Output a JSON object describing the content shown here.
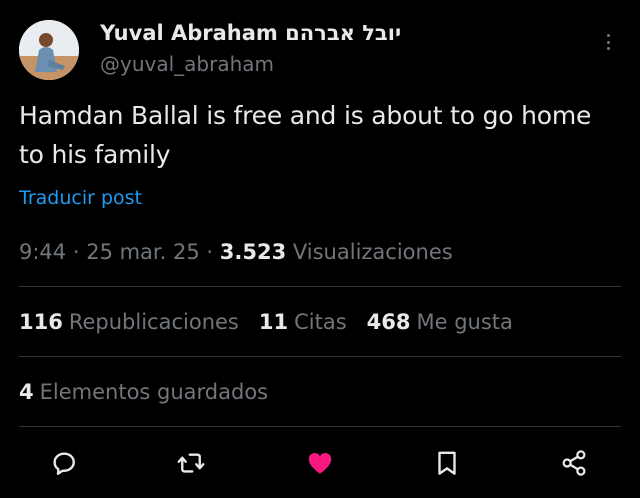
{
  "author": {
    "display_name": "Yuval Abraham יובל אברהם",
    "handle": "@yuval_abraham"
  },
  "post": {
    "text": "Hamdan Ballal is free and is about to go home to his family",
    "translate_label": "Traducir post"
  },
  "meta": {
    "time": "9:44",
    "date": "25 mar. 25",
    "views_count": "3.523",
    "views_label": "Visualizaciones"
  },
  "stats": {
    "reposts_count": "116",
    "reposts_label": "Republicaciones",
    "quotes_count": "11",
    "quotes_label": "Citas",
    "likes_count": "468",
    "likes_label": "Me gusta"
  },
  "saved": {
    "count": "4",
    "label": "Elementos guardados"
  },
  "colors": {
    "background": "#000000",
    "text_primary": "#e7e9ea",
    "text_secondary": "#71767b",
    "link": "#1d9bf0",
    "like_active": "#f91880",
    "divider": "#2f3336"
  },
  "icons": {
    "reply": "reply-icon",
    "repost": "repost-icon",
    "like": "heart-filled-icon",
    "bookmark": "bookmark-icon",
    "share": "share-icon",
    "more": "more-vertical-icon"
  }
}
